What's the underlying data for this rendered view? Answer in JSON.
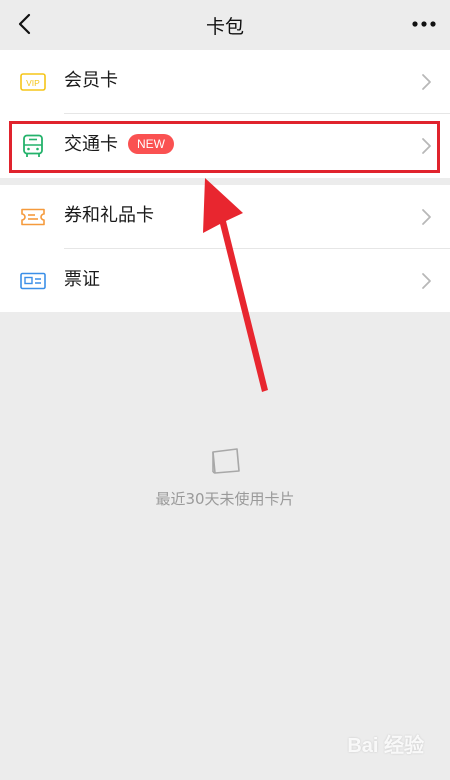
{
  "header": {
    "title": "卡包",
    "back_icon": "chevron-left-icon",
    "more_icon": "more-horizontal-icon"
  },
  "items": [
    {
      "label": "会员卡",
      "icon": "vip-card-icon",
      "icon_color": "#f5c518"
    },
    {
      "label": "交通卡",
      "icon": "bus-icon",
      "icon_color": "#24b26b",
      "badge": "NEW"
    },
    {
      "label": "券和礼品卡",
      "icon": "ticket-icon",
      "icon_color": "#f59a3c"
    },
    {
      "label": "票证",
      "icon": "id-card-icon",
      "icon_color": "#3b8fe8"
    }
  ],
  "empty_state": {
    "icon": "card-icon",
    "text": "最近30天未使用卡片"
  },
  "annotation": {
    "highlight_color": "#e0232d",
    "arrow_color": "#e8262f"
  },
  "watermark": "Bai 经验"
}
